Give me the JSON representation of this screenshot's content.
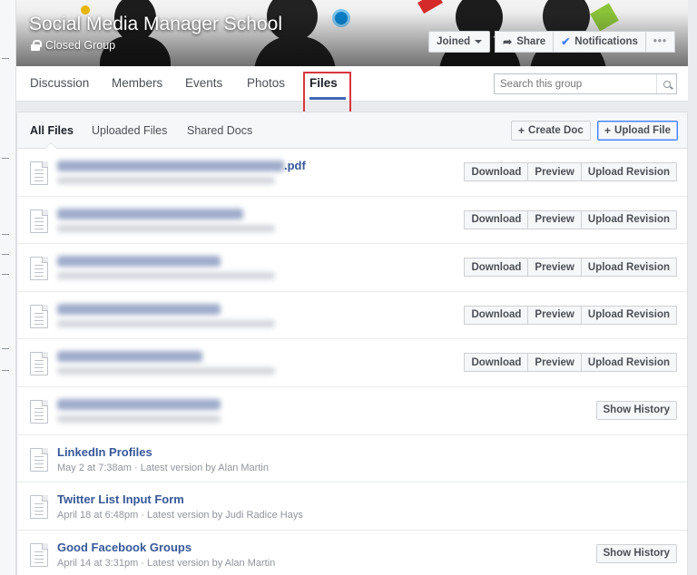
{
  "group": {
    "title": "Social Media Manager School",
    "privacy": "Closed Group",
    "actions": {
      "joined": "Joined",
      "share": "Share",
      "notifications": "Notifications",
      "more": "•••"
    }
  },
  "nav": {
    "tabs": [
      "Discussion",
      "Members",
      "Events",
      "Photos",
      "Files"
    ],
    "active": "Files",
    "search_placeholder": "Search this group"
  },
  "files": {
    "tabs": [
      "All Files",
      "Uploaded Files",
      "Shared Docs"
    ],
    "create_doc": "Create Doc",
    "upload_file": "Upload File",
    "actions": {
      "download": "Download",
      "preview": "Preview",
      "upload_revision": "Upload Revision",
      "show_history": "Show History"
    },
    "rows": [
      {
        "name": ".pdf",
        "meta": "",
        "buttons": "full",
        "blurred": true
      },
      {
        "name": "",
        "meta": "",
        "buttons": "full",
        "blurred": true
      },
      {
        "name": "",
        "meta": "",
        "buttons": "full",
        "blurred": true
      },
      {
        "name": "",
        "meta": "",
        "buttons": "full",
        "blurred": true
      },
      {
        "name": "",
        "meta": "",
        "buttons": "full",
        "blurred": true
      },
      {
        "name": "",
        "meta": "",
        "buttons": "history",
        "blurred": true
      },
      {
        "name": "LinkedIn Profiles",
        "meta": "May 2 at 7:38am · Latest version by Alan Martin",
        "buttons": "none",
        "blurred": false
      },
      {
        "name": "Twitter List Input Form",
        "meta": "April 18 at 6:48pm · Latest version by Judi Radice Hays",
        "buttons": "none",
        "blurred": false
      },
      {
        "name": "Good Facebook Groups",
        "meta": "April 14 at 3:31pm · Latest version by Alan Martin",
        "buttons": "history",
        "blurred": false
      }
    ]
  },
  "colors": {
    "link": "#365899",
    "highlight": "#d9363e",
    "accent": "#4267b2"
  }
}
